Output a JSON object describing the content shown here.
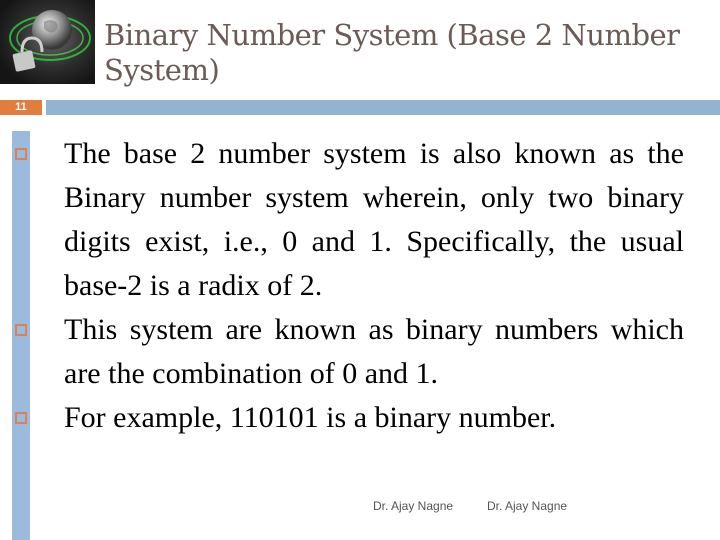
{
  "slide": {
    "number": "11",
    "title": "Binary Number System (Base 2 Number System)",
    "logo_icon": "globe-padlock-security-image",
    "colors": {
      "title": "#6b5b57",
      "slide_number_badge": "#e07d3f",
      "header_bar": "#93b4d1",
      "side_bar": "#9bbadc",
      "bullet": "#d9825b"
    },
    "bullets": [
      {
        "icon": "hollow-square-bullet-icon",
        "text": "The base 2 number system is also known as  the Binary  number  system wherein, only two binary digits exist, i.e., 0 and 1. Specifically, the usual base-2 is a radix of 2."
      },
      {
        "icon": "hollow-square-bullet-icon",
        "text": "This system are known as binary numbers which are the combination of 0 and 1."
      },
      {
        "icon": "hollow-square-bullet-icon",
        "text": "For example, 110101 is a binary number."
      }
    ],
    "footer": [
      "Dr. Ajay Nagne",
      "Dr. Ajay Nagne"
    ]
  }
}
